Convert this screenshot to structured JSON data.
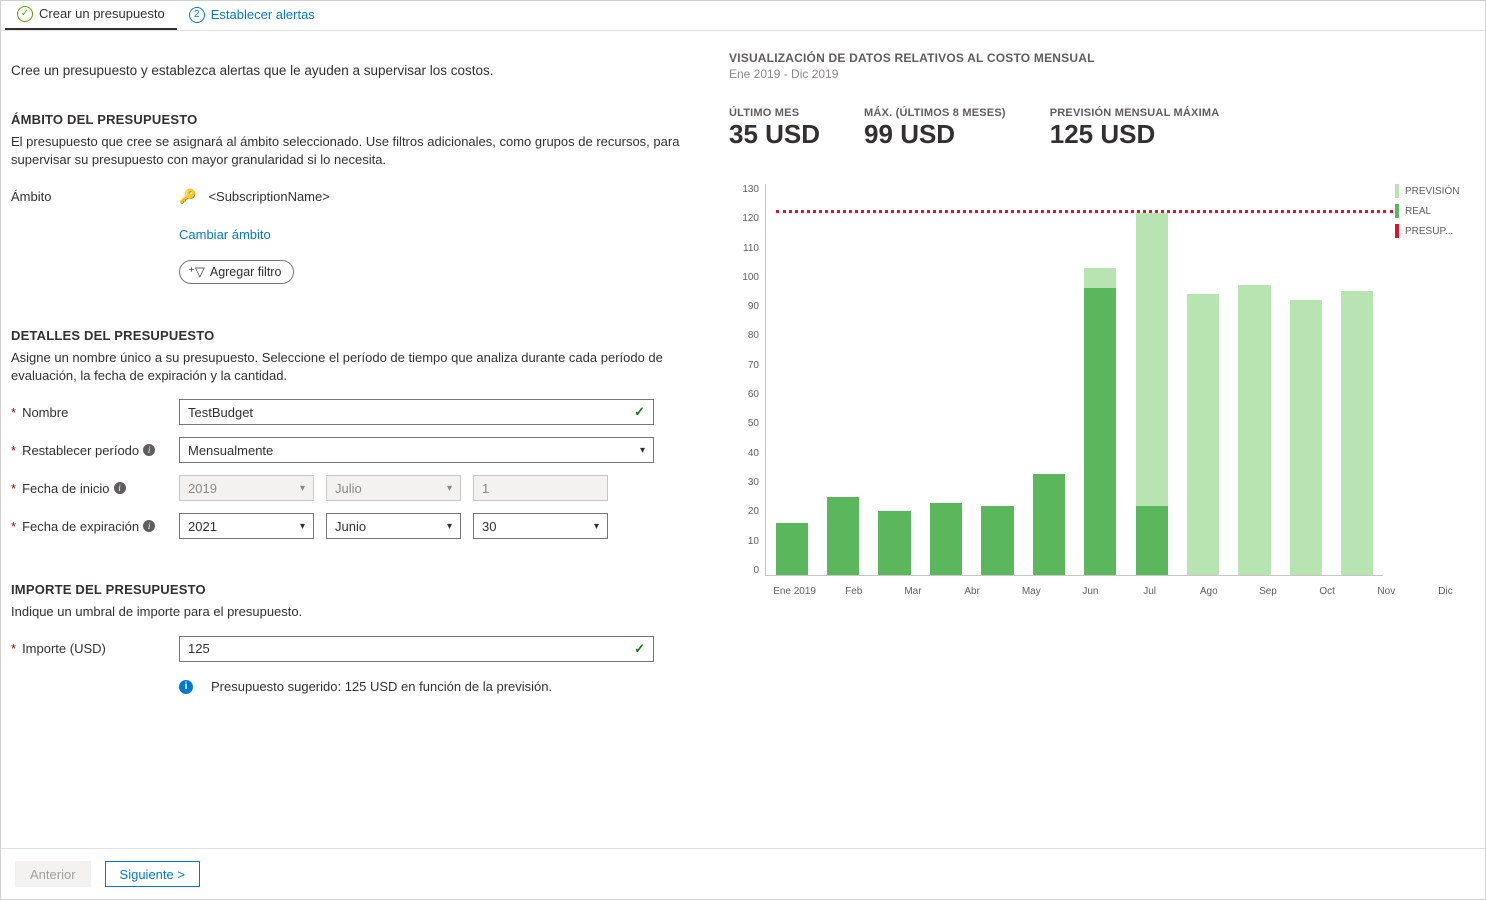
{
  "tabs": {
    "step1": "Crear un presupuesto",
    "step2_num": "2",
    "step2": "Establecer alertas"
  },
  "intro": "Cree un presupuesto y establezca alertas que le ayuden a supervisar los costos.",
  "scope": {
    "heading": "ÁMBITO DEL PRESUPUESTO",
    "helper": "El presupuesto que cree se asignará al ámbito seleccionado. Use filtros adicionales, como grupos de recursos, para supervisar su presupuesto con mayor granularidad si lo necesita.",
    "label": "Ámbito",
    "value": "<SubscriptionName>",
    "change_link": "Cambiar ámbito",
    "add_filter": "Agregar filtro"
  },
  "details": {
    "heading": "DETALLES DEL PRESUPUESTO",
    "helper": "Asigne un nombre único a su presupuesto. Seleccione el período de tiempo que analiza durante cada período de evaluación, la fecha de expiración y la cantidad.",
    "name_label": "Nombre",
    "name_value": "TestBudget",
    "reset_label": "Restablecer período",
    "reset_value": "Mensualmente",
    "start_label": "Fecha de inicio",
    "start_year": "2019",
    "start_month": "Julio",
    "start_day": "1",
    "end_label": "Fecha de expiración",
    "end_year": "2021",
    "end_month": "Junio",
    "end_day": "30"
  },
  "amount": {
    "heading": "IMPORTE DEL PRESUPUESTO",
    "helper": "Indique un umbral de importe para el presupuesto.",
    "label": "Importe (USD)",
    "value": "125",
    "suggestion": "Presupuesto sugerido: 125 USD en función de la previsión."
  },
  "footer": {
    "prev": "Anterior",
    "next": "Siguiente  >"
  },
  "viz": {
    "title": "VISUALIZACIÓN DE DATOS RELATIVOS AL COSTO MENSUAL",
    "subtitle": "Ene 2019 - Dic 2019",
    "stats": {
      "last_label": "ÚLTIMO MES",
      "last_value": "35 USD",
      "max_label": "MÁX. (ÚLTIMOS 8 MESES)",
      "max_value": "99 USD",
      "forecast_label": "PREVISIÓN MENSUAL MÁXIMA",
      "forecast_value": "125 USD"
    },
    "legend": {
      "forecast": "PREVISIÓN",
      "real": "REAL",
      "budget": "PRESUP..."
    }
  },
  "chart_data": {
    "type": "bar",
    "categories": [
      "Ene 2019",
      "Feb",
      "Mar",
      "Abr",
      "May",
      "Jun",
      "Jul",
      "Ago",
      "Sep",
      "Oct",
      "Nov",
      "Dic"
    ],
    "y_ticks": [
      0,
      10,
      20,
      30,
      40,
      50,
      60,
      70,
      80,
      90,
      100,
      110,
      120,
      130
    ],
    "budget_line": 125,
    "ylim": [
      0,
      135
    ],
    "series": [
      {
        "name": "REAL",
        "color": "#5bb75b",
        "values": [
          18,
          27,
          22,
          25,
          24,
          35,
          99,
          24,
          null,
          null,
          null,
          null
        ]
      },
      {
        "name": "PREVISIÓN",
        "color": "#b7e4b0",
        "values": [
          null,
          null,
          null,
          null,
          null,
          null,
          106,
          125,
          97,
          100,
          95,
          98
        ]
      }
    ],
    "xlabel": "",
    "ylabel": "",
    "title": "VISUALIZACIÓN DE DATOS RELATIVOS AL COSTO MENSUAL"
  }
}
